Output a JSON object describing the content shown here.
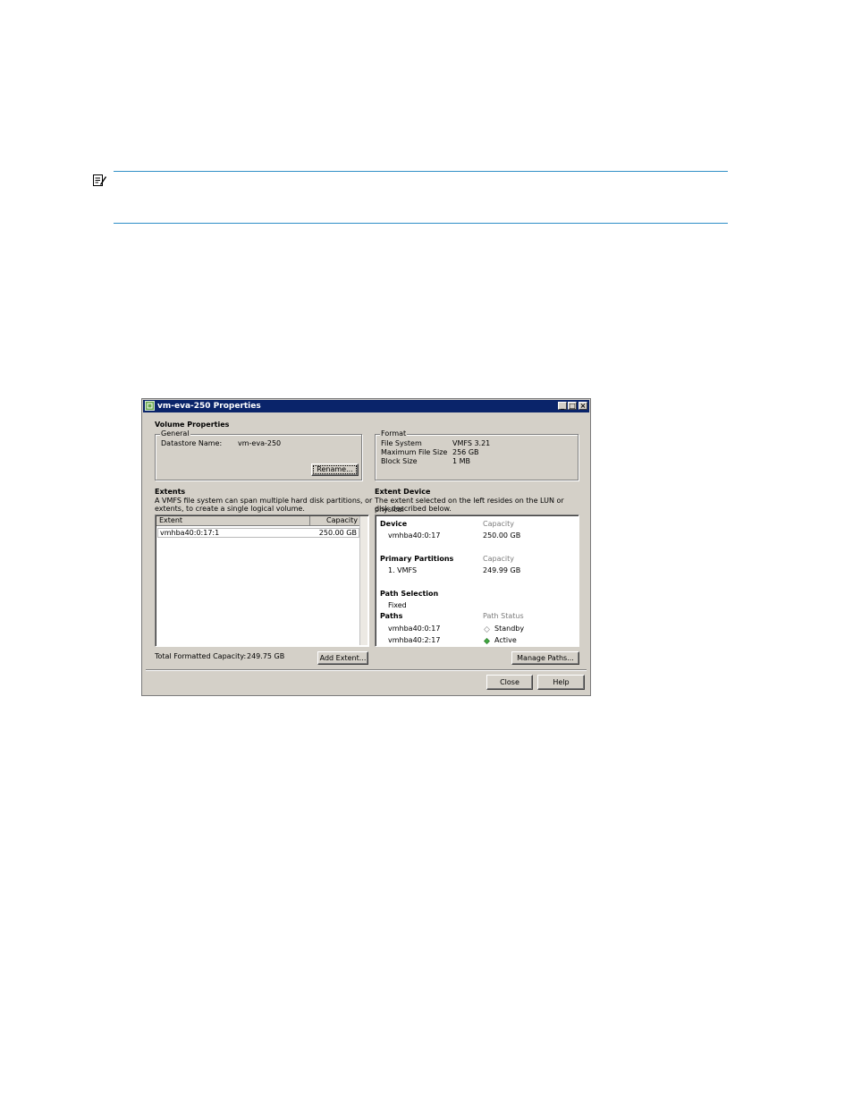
{
  "window": {
    "title": "vm-eva-250 Properties",
    "controls": [
      "_",
      "□",
      "×"
    ]
  },
  "volume_properties": {
    "heading": "Volume Properties",
    "general": {
      "legend": "General",
      "datastore_label": "Datastore Name:",
      "datastore_value": "vm-eva-250",
      "rename_button": "Rename..."
    },
    "format": {
      "legend": "Format",
      "rows": [
        {
          "label": "File System",
          "value": "VMFS 3.21"
        },
        {
          "label": "Maximum File Size",
          "value": "256 GB"
        },
        {
          "label": "Block Size",
          "value": "1 MB"
        }
      ]
    }
  },
  "extents": {
    "heading": "Extents",
    "description_line1": "A VMFS file system can span multiple hard disk partitions, or",
    "description_line2": "extents, to create a single logical volume.",
    "columns": [
      "Extent",
      "Capacity"
    ],
    "rows": [
      {
        "extent": "vmhba40:0:17:1",
        "capacity": "250.00 GB"
      }
    ],
    "total_label": "Total Formatted Capacity:",
    "total_value": "249.75 GB",
    "add_button": "Add Extent..."
  },
  "extent_device": {
    "heading": "Extent Device",
    "description_line1": "The extent selected on the left resides on the LUN or physical",
    "description_line2": "disk described below.",
    "device": {
      "label": "Device",
      "capacity_label": "Capacity",
      "name": "vmhba40:0:17",
      "capacity": "250.00 GB"
    },
    "partitions": {
      "label": "Primary Partitions",
      "capacity_label": "Capacity",
      "name": "1. VMFS",
      "capacity": "249.99 GB"
    },
    "path_selection": {
      "label": "Path Selection",
      "value": "Fixed"
    },
    "paths": {
      "label": "Paths",
      "status_label": "Path Status",
      "rows": [
        {
          "path": "vmhba40:0:17",
          "status": "Standby",
          "status_color": "#ffffff"
        },
        {
          "path": "vmhba40:2:17",
          "status": "Active",
          "status_color": "#3fa63f"
        }
      ]
    },
    "manage_button": "Manage Paths..."
  },
  "footer": {
    "close_button": "Close",
    "help_button": "Help"
  }
}
